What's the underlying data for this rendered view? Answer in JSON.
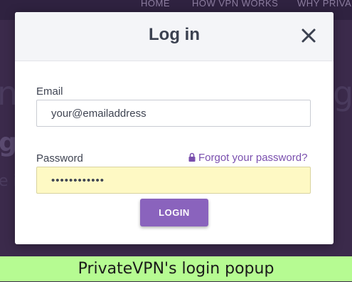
{
  "background": {
    "nav_items": [
      "HOME",
      "HOW VPN WORKS",
      "WHY PRIVA"
    ]
  },
  "modal": {
    "title": "Log in",
    "close_icon": "close-icon",
    "email": {
      "label": "Email",
      "value": "your@emailaddress"
    },
    "password": {
      "label": "Password",
      "value": "••••••••••••",
      "forgot_label": "Forgot your password?",
      "forgot_icon": "lock-icon"
    },
    "login_label": "LOGIN"
  },
  "caption": "PrivateVPN's login popup",
  "colors": {
    "accent": "#8a63bd",
    "link": "#7a4fae",
    "autofill": "#fef9c4",
    "caption_bg": "#b6fb92",
    "overlay": "#3b2a4b"
  }
}
